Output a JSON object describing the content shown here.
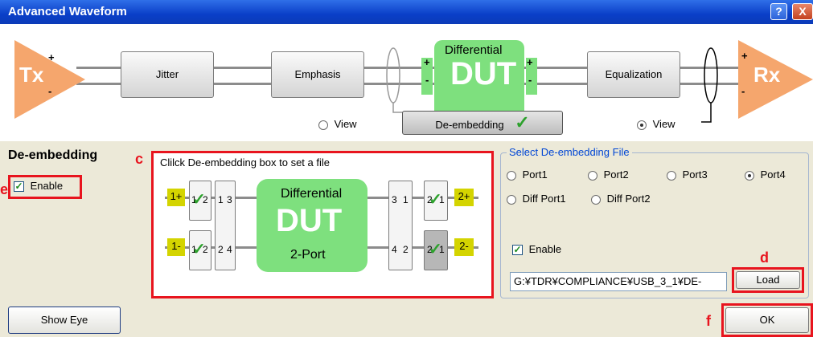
{
  "window": {
    "title": "Advanced Waveform",
    "help": "?",
    "close": "X"
  },
  "pipeline": {
    "tx": "Tx",
    "rx": "Rx",
    "jitter": "Jitter",
    "emphasis": "Emphasis",
    "dut_title": "Differential",
    "dut": "DUT",
    "equalization": "Equalization",
    "view_left": "View",
    "view_right": "View",
    "deembed_button": "De-embedding",
    "plus": "+",
    "minus": "-"
  },
  "left": {
    "title": "De-embedding",
    "enable": "Enable",
    "enable_checked": true
  },
  "diagram": {
    "hint": "Clilck De-embedding box to set a file",
    "dut_title": "Differential",
    "dut": "DUT",
    "dut_sub": "2-Port",
    "pad_in_top": "1+",
    "pad_in_bottom": "1-",
    "pad_out_top": "2+",
    "pad_out_bottom": "2-",
    "port_labels": {
      "l_a": "1",
      "l_b": "2",
      "l_c": "2",
      "l_d": "4",
      "r_a": "3",
      "r_b": "1",
      "r_c": "4",
      "r_d": "2",
      "s1": "1",
      "s2": "2",
      "s3": "1",
      "s4": "2",
      "s5": "2",
      "s6": "1",
      "s7": "2",
      "s8": "1"
    }
  },
  "select": {
    "legend": "Select De-embedding File",
    "options": [
      "Port1",
      "Port2",
      "Port3",
      "Port4",
      "Diff Port1",
      "Diff Port2"
    ],
    "selected": "Port4",
    "enable": "Enable",
    "enable_checked": true,
    "file_path": "G:¥TDR¥COMPLIANCE¥USB_3_1¥DE-",
    "load": "Load"
  },
  "footer": {
    "show_eye": "Show Eye",
    "ok": "OK"
  },
  "annotations": {
    "c": "c",
    "d": "d",
    "e": "e",
    "f": "f"
  },
  "colors": {
    "title_bar": "#0a3fc8",
    "tx_rx": "#f5a66d",
    "dut": "#7ee07e",
    "pad": "#d4d400",
    "highlight": "#e8141e"
  }
}
